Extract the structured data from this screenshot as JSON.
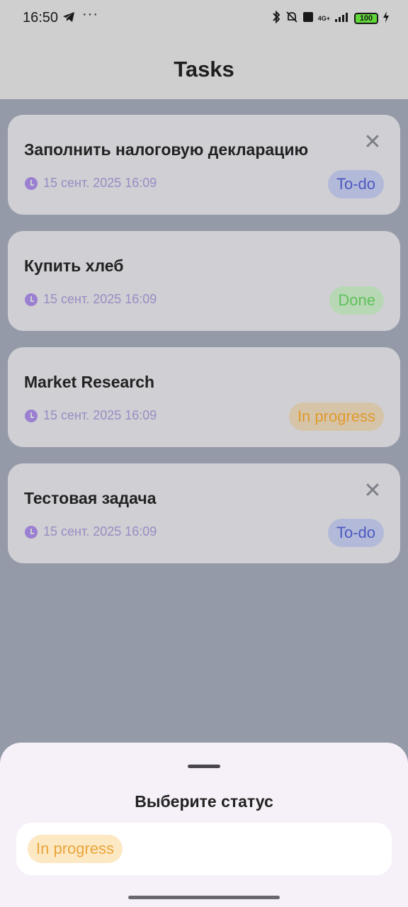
{
  "status_bar": {
    "time": "16:50",
    "dots": "···",
    "signal": "4G+",
    "battery": "100"
  },
  "app": {
    "title": "Tasks"
  },
  "tasks": [
    {
      "title": "Заполнить налоговую декларацию",
      "datetime": "15 сент. 2025 16:09",
      "status": "To-do",
      "status_color": "#4b5ac0",
      "has_delete": true
    },
    {
      "title": "Купить хлеб",
      "datetime": "15 сент. 2025 16:09",
      "status": "Done",
      "status_color": "#5ec05a",
      "has_delete": false
    },
    {
      "title": "Market Research",
      "datetime": "15 сент. 2025 16:09",
      "status": "In progress",
      "status_color": "#e09b2d",
      "has_delete": false
    },
    {
      "title": "Тестовая задача",
      "datetime": "15 сент. 2025 16:09",
      "status": "To-do",
      "status_color": "#4b5ac0",
      "has_delete": true
    }
  ],
  "sheet": {
    "title": "Выберите статус",
    "options": [
      "In progress"
    ]
  },
  "icons": {
    "delete": "close-icon",
    "time": "clock-icon"
  }
}
